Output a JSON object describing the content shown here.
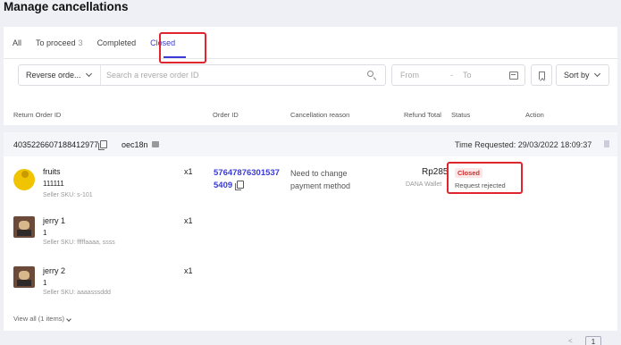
{
  "page": {
    "title": "Manage cancellations"
  },
  "tabs": [
    {
      "label": "All",
      "count": ""
    },
    {
      "label": "To proceed",
      "count": "3"
    },
    {
      "label": "Completed",
      "count": ""
    },
    {
      "label": "Closed",
      "count": ""
    }
  ],
  "active_tab": "Closed",
  "filters": {
    "search_type": "Reverse orde...",
    "search_placeholder": "Search a reverse order ID",
    "date_from_placeholder": "From",
    "date_separator": "-",
    "date_to_placeholder": "To",
    "sort_label": "Sort by"
  },
  "table": {
    "columns": {
      "return_order_id": "Return Order ID",
      "order_id": "Order ID",
      "reason": "Cancellation reason",
      "refund_total": "Refund Total",
      "status": "Status",
      "action": "Action"
    },
    "order": {
      "return_order_id": "4035226607188412977",
      "shop": "oec18n",
      "time_requested": "Time Requested: 29/03/2022 18:09:37",
      "order_id_line1": "57647876301537",
      "order_id_line2": "5409",
      "reason_line1": "Need to change",
      "reason_line2": "payment method",
      "refund_amount": "Rp285",
      "payment_method": "DANA Wallet",
      "status": "Closed",
      "status_detail": "Request rejected",
      "items": [
        {
          "name": "fruits",
          "variant": "111111",
          "sku": "Seller SKU: s-101",
          "qty": "x1",
          "thumb": "fruit-image"
        },
        {
          "name": "jerry 1",
          "variant": "1",
          "sku": "Seller SKU: fffffaaaa, ssss",
          "qty": "x1",
          "thumb": "jerry-image"
        },
        {
          "name": "jerry 2",
          "variant": "1",
          "sku": "Seller SKU: aaaasssddd",
          "qty": "x1",
          "thumb": "jerry-image"
        }
      ],
      "view_all": "View all (1 items)"
    }
  },
  "pagination": {
    "prev": "<",
    "current": "1"
  },
  "colors": {
    "accent": "#3b3bd6",
    "annotation": "#e1252e",
    "status_closed": "#d32f2f"
  }
}
